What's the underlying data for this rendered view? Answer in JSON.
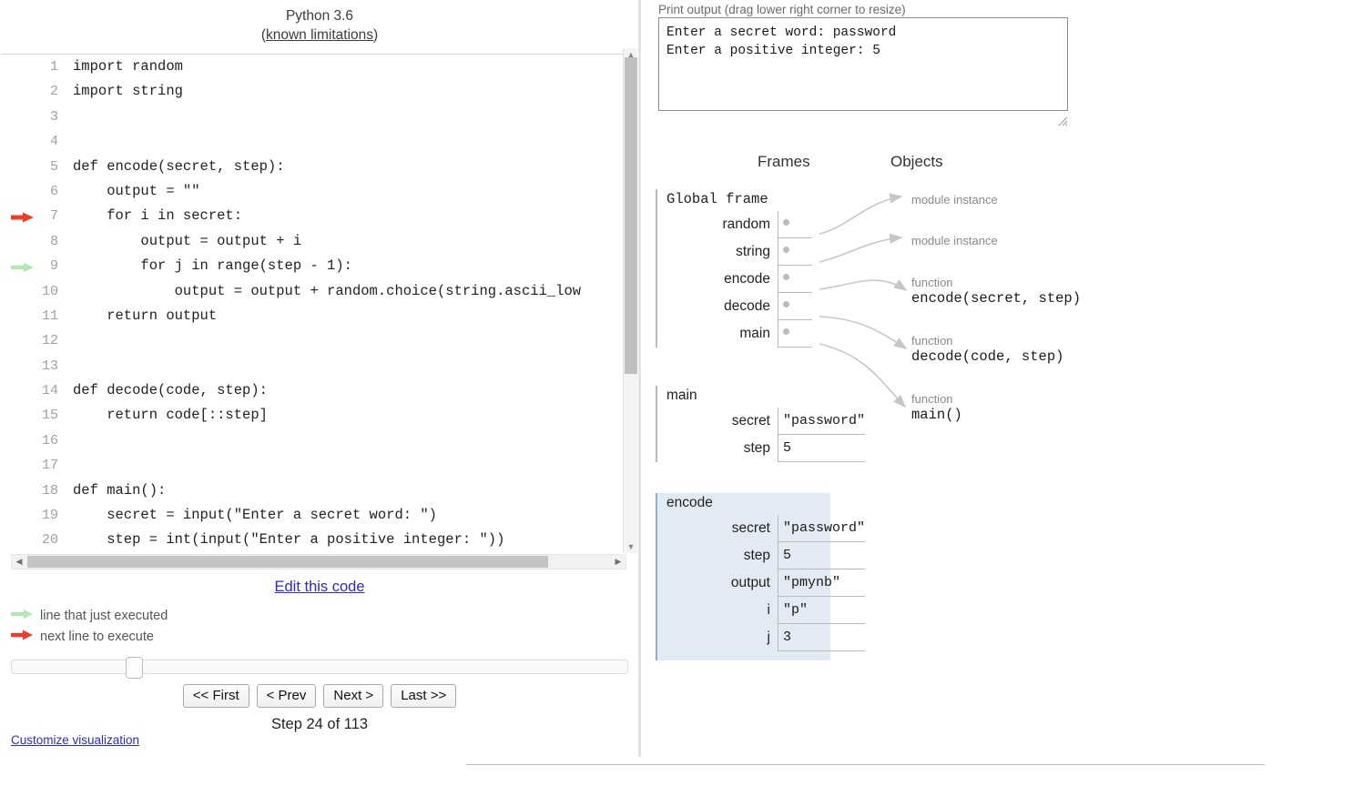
{
  "left": {
    "python_version": "Python 3.6",
    "limitations_prefix": "(",
    "limitations_link": "known limitations",
    "limitations_suffix": ")",
    "code_lines": [
      {
        "num": "1",
        "text": "import random",
        "marker": "none"
      },
      {
        "num": "2",
        "text": "import string",
        "marker": "none"
      },
      {
        "num": "3",
        "text": "",
        "marker": "none"
      },
      {
        "num": "4",
        "text": "",
        "marker": "none"
      },
      {
        "num": "5",
        "text": "def encode(secret, step):",
        "marker": "none"
      },
      {
        "num": "6",
        "text": "    output = \"\"",
        "marker": "none"
      },
      {
        "num": "7",
        "text": "    for i in secret:",
        "marker": "next"
      },
      {
        "num": "8",
        "text": "        output = output + i",
        "marker": "none"
      },
      {
        "num": "9",
        "text": "        for j in range(step - 1):",
        "marker": "executed"
      },
      {
        "num": "10",
        "text": "            output = output + random.choice(string.ascii_low",
        "marker": "none"
      },
      {
        "num": "11",
        "text": "    return output",
        "marker": "none"
      },
      {
        "num": "12",
        "text": "",
        "marker": "none"
      },
      {
        "num": "13",
        "text": "",
        "marker": "none"
      },
      {
        "num": "14",
        "text": "def decode(code, step):",
        "marker": "none"
      },
      {
        "num": "15",
        "text": "    return code[::step]",
        "marker": "none"
      },
      {
        "num": "16",
        "text": "",
        "marker": "none"
      },
      {
        "num": "17",
        "text": "",
        "marker": "none"
      },
      {
        "num": "18",
        "text": "def main():",
        "marker": "none"
      },
      {
        "num": "19",
        "text": "    secret = input(\"Enter a secret word: \")",
        "marker": "none"
      },
      {
        "num": "20",
        "text": "    step = int(input(\"Enter a positive integer: \"))",
        "marker": "none"
      }
    ],
    "edit_code_label": "Edit this code",
    "legend": {
      "executed": "line that just executed",
      "next": "next line to execute"
    },
    "buttons": [
      {
        "label": "<< First",
        "name": "first-button"
      },
      {
        "label": "< Prev",
        "name": "prev-button"
      },
      {
        "label": "Next >",
        "name": "next-button"
      },
      {
        "label": "Last >>",
        "name": "last-button"
      }
    ],
    "step_label": "Step 24 of 113",
    "customize_link": "Customize visualization",
    "slider_percent": 19
  },
  "right": {
    "print_output_label": "Print output (drag lower right corner to resize)",
    "print_output_text": "Enter a secret word: password\nEnter a positive integer: 5",
    "frames_header": "Frames",
    "objects_header": "Objects",
    "frames": [
      {
        "title": "Global frame",
        "title_mono": true,
        "highlighted": false,
        "vars": [
          {
            "name": "random",
            "kind": "pointer"
          },
          {
            "name": "string",
            "kind": "pointer"
          },
          {
            "name": "encode",
            "kind": "pointer"
          },
          {
            "name": "decode",
            "kind": "pointer"
          },
          {
            "name": "main",
            "kind": "pointer"
          }
        ]
      },
      {
        "title": "main",
        "title_mono": false,
        "highlighted": false,
        "vars": [
          {
            "name": "secret",
            "kind": "value",
            "value": "\"password\""
          },
          {
            "name": "step",
            "kind": "value",
            "value": "5"
          }
        ]
      },
      {
        "title": "encode",
        "title_mono": false,
        "highlighted": true,
        "vars": [
          {
            "name": "secret",
            "kind": "value",
            "value": "\"password\""
          },
          {
            "name": "step",
            "kind": "value",
            "value": "5"
          },
          {
            "name": "output",
            "kind": "value",
            "value": "\"pmynb\""
          },
          {
            "name": "i",
            "kind": "value",
            "value": "\"p\""
          },
          {
            "name": "j",
            "kind": "value",
            "value": "3"
          }
        ]
      }
    ],
    "objects": [
      {
        "label": "module instance",
        "signature": ""
      },
      {
        "label": "module instance",
        "signature": ""
      },
      {
        "label": "function",
        "signature": "encode(secret, step)"
      },
      {
        "label": "function",
        "signature": "decode(code, step)"
      },
      {
        "label": "function",
        "signature": "main()"
      }
    ]
  },
  "colors": {
    "next_arrow": "#e8402a",
    "executed_arrow": "#b2e6b2",
    "link": "#2b2bbd",
    "frame_highlight_bg": "#e2eaf4",
    "frame_highlight_border": "#9aadc6",
    "pointer_gray": "#bbbbbb",
    "object_label_gray": "#8a8a8a"
  }
}
